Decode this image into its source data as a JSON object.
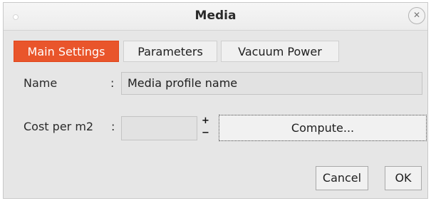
{
  "window": {
    "title": "Media",
    "close_glyph": "✕"
  },
  "tabs": [
    {
      "label": "Main Settings",
      "active": true
    },
    {
      "label": "Parameters",
      "active": false
    },
    {
      "label": "Vacuum Power",
      "active": false
    }
  ],
  "form": {
    "name_label": "Name",
    "name_sep": ":",
    "name_value": "Media profile name",
    "cost_label": "Cost per m2",
    "cost_sep": ":",
    "cost_value": "",
    "plus_glyph": "+",
    "minus_glyph": "−",
    "compute_label": "Compute..."
  },
  "footer": {
    "cancel_label": "Cancel",
    "ok_label": "OK"
  },
  "colors": {
    "active_tab": "#e9552b",
    "panel": "#e6e6e6"
  }
}
